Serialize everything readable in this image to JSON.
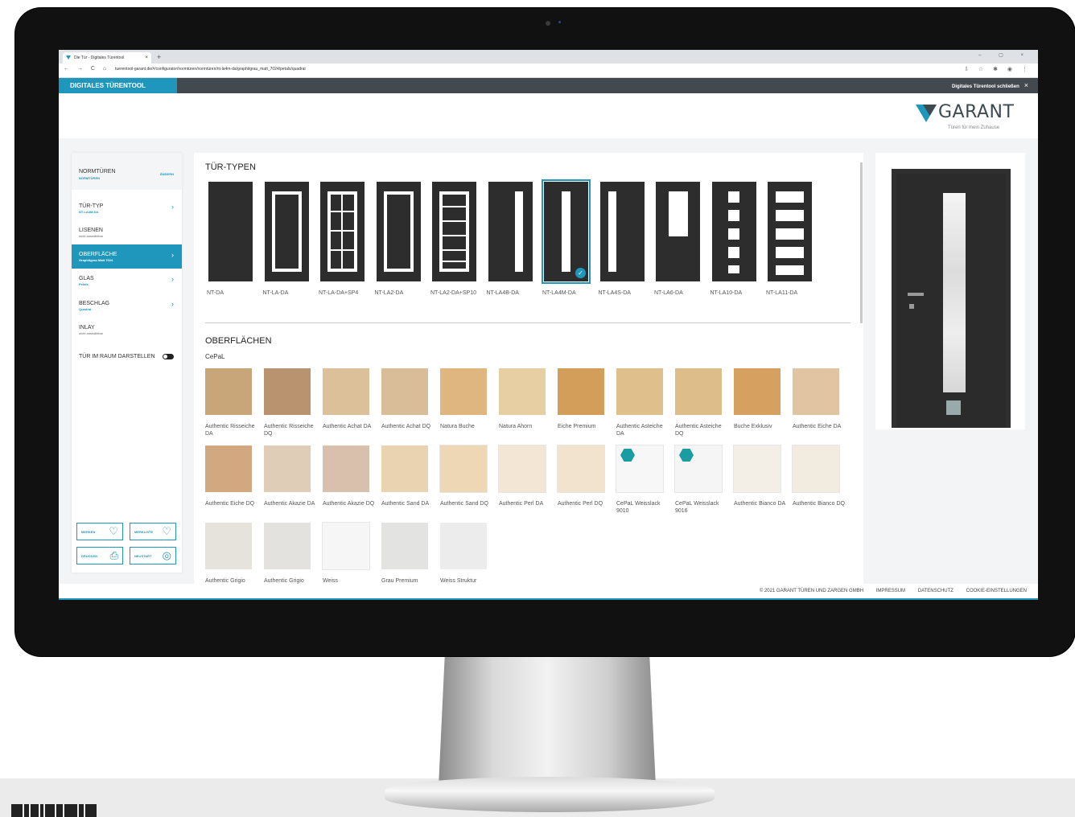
{
  "browser": {
    "tab_title": "Die Tür - Digitales Türentool",
    "close_tab": "×",
    "new_tab": "+",
    "window_controls": "– ▢ ×",
    "nav_icons": "← → C ⌂",
    "url": "tuerentool-garant.de/#/configurator/normtüren/normtüren/nt-la4m-da/graphitgrau_matt_7024/petals/quadrat",
    "extension_icons": "⇩ ☆ ✱ ◉ ⋮"
  },
  "app": {
    "title": "DIGITALES TÜRENTOOL",
    "close_label": "Digitales Türentool schließen",
    "close_icon": "×",
    "logo": {
      "name": "GARANT",
      "tagline": "Türen für mein Zuhause",
      "accent": "#1f97bd"
    }
  },
  "sidebar": {
    "header": {
      "title": "NORMTÜREN",
      "subtitle": "NORMTÜREN",
      "edit": "ÄNDERN"
    },
    "steps": [
      {
        "label": "TÜR-TYP",
        "value": "NT-LA4M-DA",
        "active": false,
        "chevron": "›"
      },
      {
        "label": "LISENEN",
        "value": "nicht auswählbar",
        "active": false,
        "chevron": ""
      },
      {
        "label": "OBERFLÄCHE",
        "value": "Graphitgrau Matt 7024",
        "active": true,
        "chevron": "›"
      },
      {
        "label": "GLAS",
        "value": "Petals",
        "active": false,
        "chevron": "›"
      },
      {
        "label": "BESCHLAG",
        "value": "Quadrat",
        "active": false,
        "chevron": "›"
      },
      {
        "label": "INLAY",
        "value": "nicht auswählbar",
        "active": false,
        "chevron": ""
      }
    ],
    "toggle_label": "TÜR IM RAUM DARSTELLEN",
    "actions": [
      {
        "label": "MERKEN",
        "icon": "♡"
      },
      {
        "label": "MERKLISTE",
        "icon": "♡"
      },
      {
        "label": "DRUCKEN",
        "icon": "⎙"
      },
      {
        "label": "NEUSTART",
        "icon": "◎"
      }
    ]
  },
  "door_types": {
    "title": "TÜR-TYPEN",
    "items": [
      "NT-DA",
      "NT-LA-DA",
      "NT-LA-DA+SP4",
      "NT-LA2-DA",
      "NT-LA2-DA+SP10",
      "NT-LA4B-DA",
      "NT-LA4M-DA",
      "NT-LA4S-DA",
      "NT-LA6-DA",
      "NT-LA10-DA",
      "NT-LA11-DA"
    ],
    "selected": "NT-LA4M-DA",
    "check_icon": "✓"
  },
  "surfaces": {
    "title": "OBERFLÄCHEN",
    "group": "CePaL",
    "items": [
      {
        "label": "Authentic Risseiche DA",
        "color": "#c9a67a"
      },
      {
        "label": "Authentic Risseiche DQ",
        "color": "#b99370"
      },
      {
        "label": "Authentic Achat DA",
        "color": "#dcc09a"
      },
      {
        "label": "Authentic Achat DQ",
        "color": "#d8bd98"
      },
      {
        "label": "Natura Buche",
        "color": "#dfb580"
      },
      {
        "label": "Natura Ahorn",
        "color": "#e8cfa3"
      },
      {
        "label": "Eiche Premium",
        "color": "#d39e5a"
      },
      {
        "label": "Authentic Asteiche DA",
        "color": "#dfc08c"
      },
      {
        "label": "Authentic Asteiche DQ",
        "color": "#ddbd8a"
      },
      {
        "label": "Buche Exklusiv",
        "color": "#d6a060"
      },
      {
        "label": "Authentic Eiche DA",
        "color": "#e1c4a2"
      },
      {
        "label": "Authentic Eiche DQ",
        "color": "#d2a880"
      },
      {
        "label": "Authentic Akazie DA",
        "color": "#e0cdb8"
      },
      {
        "label": "Authentic Akazie DQ",
        "color": "#d9c0ad"
      },
      {
        "label": "Authentic Sand DA",
        "color": "#ead3b0"
      },
      {
        "label": "Authentic Sand DQ",
        "color": "#eed7b4"
      },
      {
        "label": "Authentic Perl DA",
        "color": "#f4e6d4"
      },
      {
        "label": "Authentic Perl DQ",
        "color": "#f2e3cf"
      },
      {
        "label": "CePaL Weisslack 9010",
        "color": "#f7f7f7",
        "badge": true
      },
      {
        "label": "CePaL Weisslack 9016",
        "color": "#f5f5f5",
        "badge": true
      },
      {
        "label": "Authentic Bianco DA",
        "color": "#f3efe6"
      },
      {
        "label": "Authentic Bianco DQ",
        "color": "#f1ebe0"
      },
      {
        "label": "Authentic Grigio",
        "color": "#e6e3dd"
      },
      {
        "label": "Authentic Grigio",
        "color": "#e4e2de"
      },
      {
        "label": "Weiss",
        "color": "#f6f6f6"
      },
      {
        "label": "Grau Premium",
        "color": "#e3e4e2"
      },
      {
        "label": "Weiss Struktur",
        "color": "#ececec"
      }
    ]
  },
  "footer": {
    "copyright": "© 2021 GARANT TÜREN UND ZARGEN GMBH",
    "links": [
      "IMPRESSUM",
      "DATENSCHUTZ",
      "COOKIE-EINSTELLUNGEN"
    ]
  }
}
